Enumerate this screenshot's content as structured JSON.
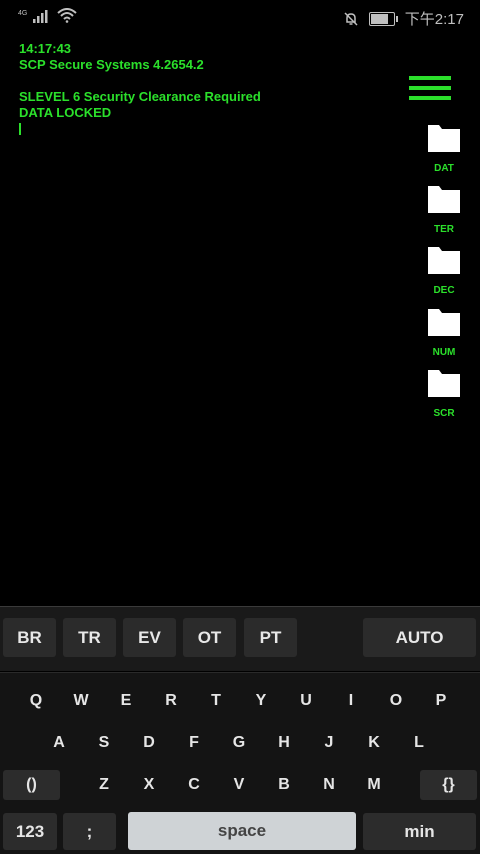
{
  "status_bar": {
    "network": "4G",
    "time": "下午2:17",
    "battery_level": 0.85
  },
  "terminal": {
    "lines": [
      "14:17:43",
      "SCP Secure Systems 4.2654.2",
      "",
      "SLEVEL 6 Security Clearance Required",
      "DATA LOCKED"
    ]
  },
  "colors": {
    "accent": "#2be02b",
    "background": "#000000"
  },
  "folders": [
    "DAT",
    "TER",
    "DEC",
    "NUM",
    "SCR"
  ],
  "shortcuts": [
    "BR",
    "TR",
    "EV",
    "OT",
    "PT"
  ],
  "auto_label": "AUTO",
  "keyboard": {
    "row1": [
      "Q",
      "W",
      "E",
      "R",
      "T",
      "Y",
      "U",
      "I",
      "O",
      "P"
    ],
    "row2": [
      "A",
      "S",
      "D",
      "F",
      "G",
      "H",
      "J",
      "K",
      "L"
    ],
    "row3": [
      "Z",
      "X",
      "C",
      "V",
      "B",
      "N",
      "M"
    ],
    "paren_key": "()",
    "brace_key": "{}",
    "num_key": "123",
    "semicolon_key": ";",
    "space_key": "space",
    "min_key": "min"
  }
}
